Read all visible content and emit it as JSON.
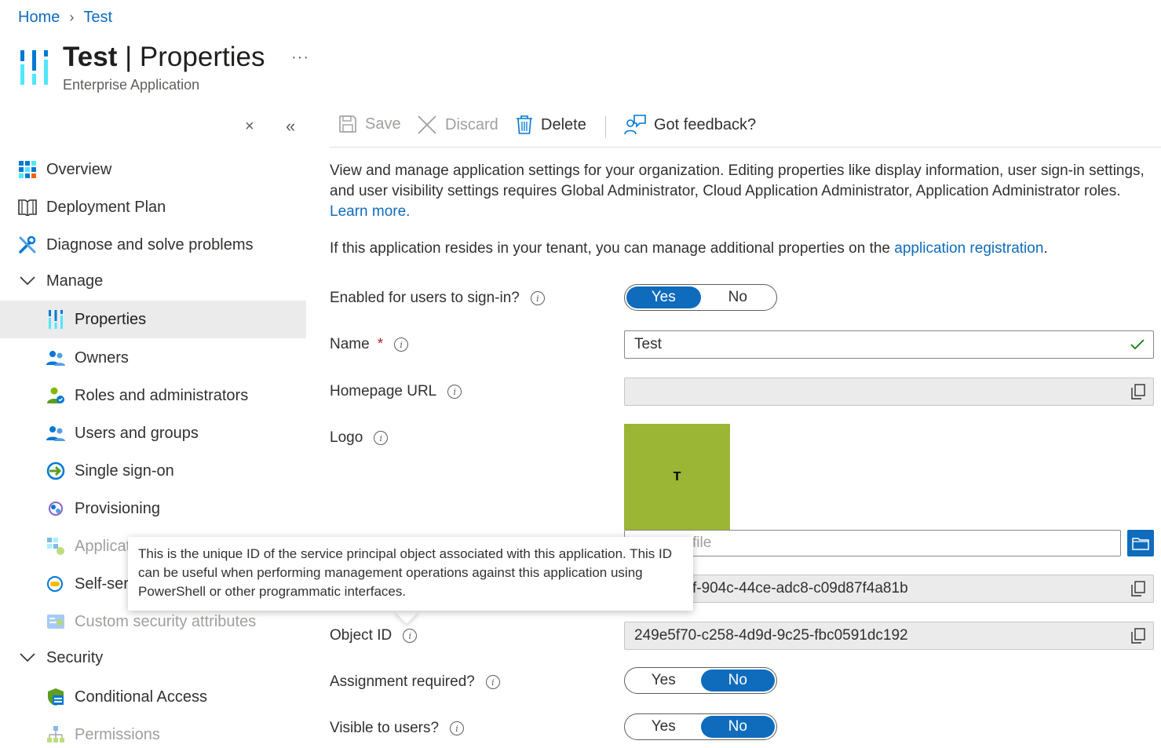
{
  "breadcrumb": [
    {
      "label": "Home"
    },
    {
      "label": "Test"
    }
  ],
  "header": {
    "title_name": "Test",
    "title_separator": " | ",
    "title_section": "Properties",
    "subtitle": "Enterprise Application",
    "more": "···"
  },
  "sidebar": {
    "close": "×",
    "collapse": "«",
    "items": [
      {
        "label": "Overview",
        "icon": "overview-icon"
      },
      {
        "label": "Deployment Plan",
        "icon": "book-icon"
      },
      {
        "label": "Diagnose and solve problems",
        "icon": "wrench-icon"
      },
      {
        "label": "Manage",
        "icon": "chevron-down-icon"
      },
      {
        "label": "Properties",
        "icon": "properties-icon",
        "selected": true
      },
      {
        "label": "Owners",
        "icon": "users-icon"
      },
      {
        "label": "Roles and administrators",
        "icon": "roles-icon"
      },
      {
        "label": "Users and groups",
        "icon": "users-icon"
      },
      {
        "label": "Single sign-on",
        "icon": "sso-icon"
      },
      {
        "label": "Provisioning",
        "icon": "provisioning-icon"
      },
      {
        "label": "Applicat",
        "icon": "app-proxy-icon"
      },
      {
        "label": "Self-serv",
        "icon": "self-service-icon"
      },
      {
        "label": "Custom security attributes",
        "icon": "attributes-icon"
      },
      {
        "label": "Security",
        "icon": "chevron-down-icon"
      },
      {
        "label": "Conditional Access",
        "icon": "conditional-access-icon"
      },
      {
        "label": "Permissions",
        "icon": "permissions-icon"
      }
    ]
  },
  "toolbar": {
    "save": "Save",
    "discard": "Discard",
    "delete": "Delete",
    "feedback": "Got feedback?"
  },
  "description": {
    "text": "View and manage application settings for your organization. Editing properties like display information, user sign-in settings, and user visibility settings requires Global Administrator, Cloud Application Administrator, Application Administrator roles.",
    "learn_more": "Learn more.",
    "tenant_text": "If this application resides in your tenant, you can manage additional properties on the",
    "tenant_link": "application registration",
    "tenant_end": "."
  },
  "form": {
    "enabled": {
      "label": "Enabled for users to sign-in?",
      "yes": "Yes",
      "no": "No",
      "value": "Yes"
    },
    "name": {
      "label": "Name",
      "required": "*",
      "value": "Test"
    },
    "homepage": {
      "label": "Homepage URL",
      "value": ""
    },
    "logo": {
      "label": "Logo",
      "initial": "T",
      "file_placeholder": "file"
    },
    "app_id_partial": "f-904c-44ce-adc8-c09d87f4a81b",
    "object_id": {
      "label": "Object ID",
      "value": "249e5f70-c258-4d9d-9c25-fbc0591dc192"
    },
    "assignment": {
      "label": "Assignment required?",
      "yes": "Yes",
      "no": "No",
      "value": "No"
    },
    "visible": {
      "label": "Visible to users?",
      "yes": "Yes",
      "no": "No",
      "value": "No"
    }
  },
  "tooltip": {
    "text": "This is the unique ID of the service principal object associated with this application. This ID can be useful when performing management operations against this application using PowerShell or other programmatic interfaces."
  },
  "colors": {
    "accent": "#0f6cbd",
    "logo_bg": "#9bb535",
    "selected_bg": "#ebebeb"
  }
}
